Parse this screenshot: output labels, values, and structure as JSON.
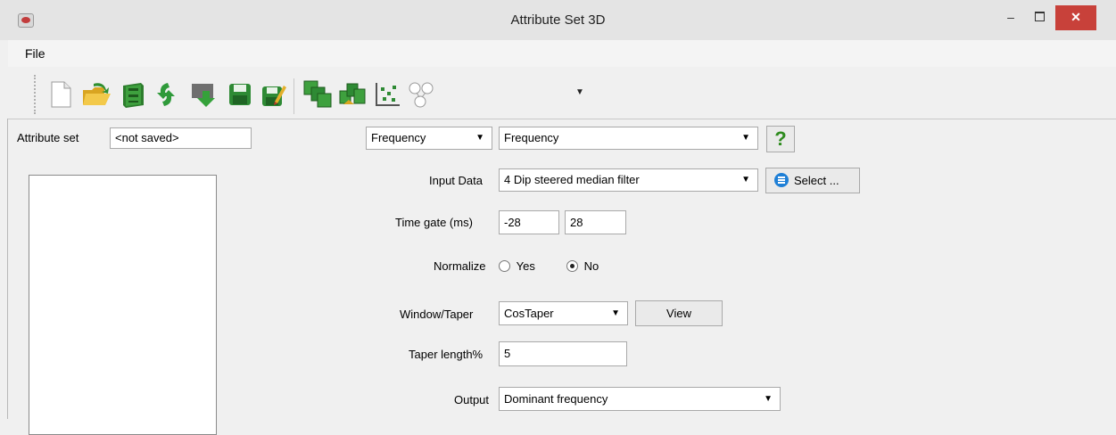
{
  "window": {
    "title": "Attribute Set 3D",
    "minimize_glyph": "–",
    "close_glyph": "✕"
  },
  "menu": {
    "file": "File"
  },
  "toolbar": {
    "icons": [
      "new-document-icon",
      "open-folder-icon",
      "database-icon",
      "reload-icon",
      "import-arrow-icon",
      "save-icon",
      "save-as-icon",
      "multi-attribute-icon",
      "cross-plot-icon",
      "scatter-plot-icon",
      "tree-graph-icon"
    ]
  },
  "attribute_set": {
    "label": "Attribute set",
    "value": "<not saved>"
  },
  "attribute_type": {
    "category": "Frequency",
    "type": "Frequency"
  },
  "help": {
    "glyph": "?"
  },
  "input_data": {
    "label": "Input Data",
    "value": "4 Dip steered median filter",
    "select_label": "Select ..."
  },
  "time_gate": {
    "label": "Time gate (ms)",
    "start": "-28",
    "end": "28"
  },
  "normalize": {
    "label": "Normalize",
    "yes": "Yes",
    "no": "No",
    "selected": "No"
  },
  "window_taper": {
    "label": "Window/Taper",
    "value": "CosTaper",
    "view_label": "View"
  },
  "taper_length": {
    "label": "Taper length%",
    "value": "5"
  },
  "output": {
    "label": "Output",
    "value": "Dominant frequency"
  },
  "colors": {
    "close_button": "#c8413a",
    "help_green": "#2e8b1e",
    "select_icon": "#1e7fd6"
  }
}
